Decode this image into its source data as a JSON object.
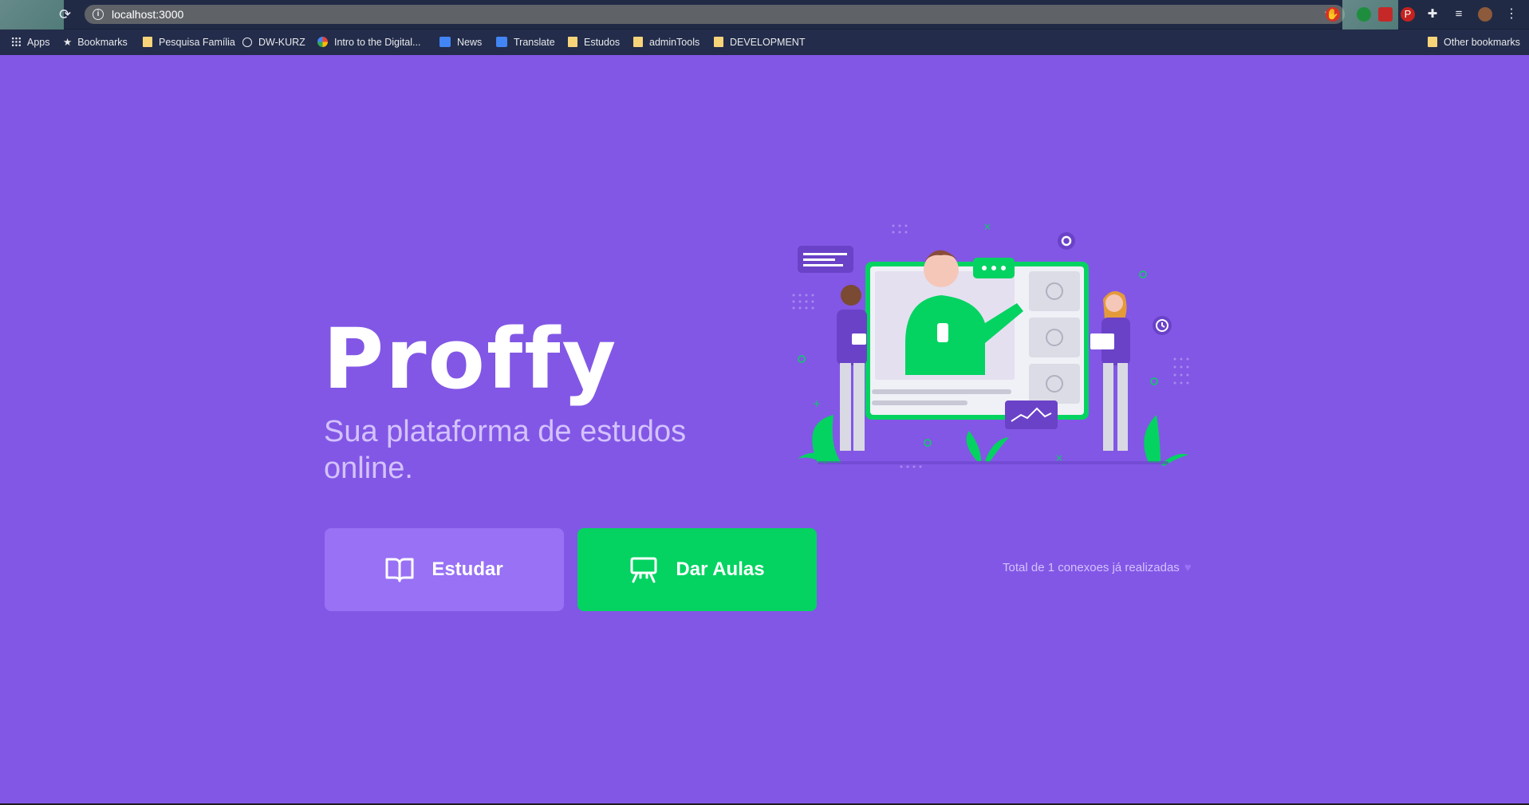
{
  "browser": {
    "url": "localhost:3000",
    "bookmarks": [
      {
        "label": "Apps",
        "icon": "apps-grid-icon"
      },
      {
        "label": "Bookmarks",
        "icon": "star-icon"
      },
      {
        "label": "Pesquisa Família",
        "icon": "folder-icon"
      },
      {
        "label": "DW-KURZ",
        "icon": "globe-icon"
      },
      {
        "label": "Intro to the Digital...",
        "icon": "google-icon"
      },
      {
        "label": "News",
        "icon": "google-news-icon"
      },
      {
        "label": "Translate",
        "icon": "google-translate-icon"
      },
      {
        "label": "Estudos",
        "icon": "folder-icon"
      },
      {
        "label": "adminTools",
        "icon": "folder-icon"
      },
      {
        "label": "DEVELOPMENT",
        "icon": "folder-icon"
      },
      {
        "label": "Other bookmarks",
        "icon": "folder-icon"
      }
    ]
  },
  "landing": {
    "logo": "Proffy",
    "tagline": "Sua plataforma de estudos online.",
    "study_label": "Estudar",
    "teach_label": "Dar Aulas",
    "connections_text": "Total de 1 conexoes já realizadas"
  },
  "colors": {
    "background": "#8257e5",
    "study_button": "#9871f5",
    "teach_button": "#04d361",
    "tagline": "#d4c2ff"
  }
}
